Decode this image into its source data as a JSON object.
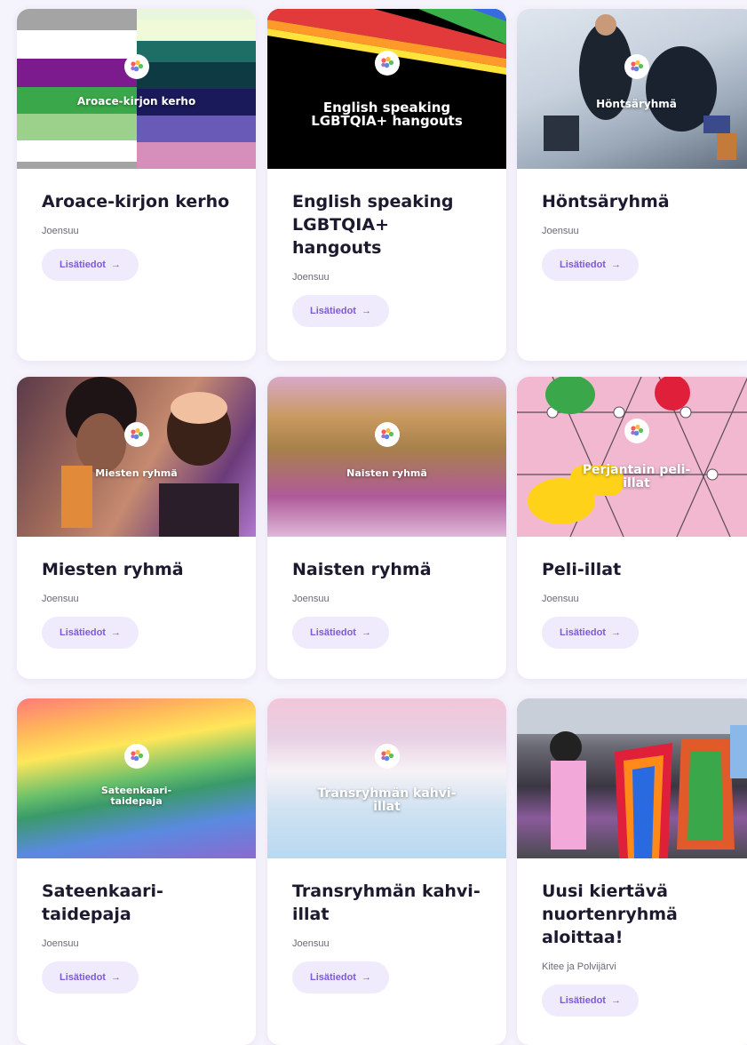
{
  "cards": [
    {
      "title": "Aroace-kirjon kerho",
      "overlay": "Aroace-kirjon kerho",
      "location": "Joensuu",
      "button": "Lisätiedot"
    },
    {
      "title": "English speaking LGBTQIA+ hangouts",
      "overlay": "English speaking LGBTQIA+ hangouts",
      "location": "Joensuu",
      "button": "Lisätiedot"
    },
    {
      "title": "Höntsäryhmä",
      "overlay": "Höntsäryhmä",
      "location": "Joensuu",
      "button": "Lisätiedot"
    },
    {
      "title": "Miesten ryhmä",
      "overlay": "Miesten ryhmä",
      "location": "Joensuu",
      "button": "Lisätiedot"
    },
    {
      "title": "Naisten ryhmä",
      "overlay": "Naisten ryhmä",
      "location": "Joensuu",
      "button": "Lisätiedot"
    },
    {
      "title": "Peli-illat",
      "overlay": "Perjantain peli-illat",
      "location": "Joensuu",
      "button": "Lisätiedot"
    },
    {
      "title": "Sateenkaari-taidepaja",
      "overlay": "Sateenkaari-taidepaja",
      "location": "Joensuu",
      "button": "Lisätiedot"
    },
    {
      "title": "Transryhmän kahvi-illat",
      "overlay": "Transryhmän kahvi-illat",
      "location": "Joensuu",
      "button": "Lisätiedot"
    },
    {
      "title": "Uusi kiertävä nuortenryhmä aloittaa!",
      "overlay": "",
      "location": "Kitee ja Polvijärvi",
      "button": "Lisätiedot"
    }
  ],
  "colors": {
    "accent": "#7d5ad6",
    "button_bg": "#efeafc",
    "title": "#1c1a2e",
    "page_bg": "#f5f3fb"
  },
  "icons": {
    "logo": "rainbow-hand-logo-icon",
    "arrow": "arrow-right-icon"
  }
}
